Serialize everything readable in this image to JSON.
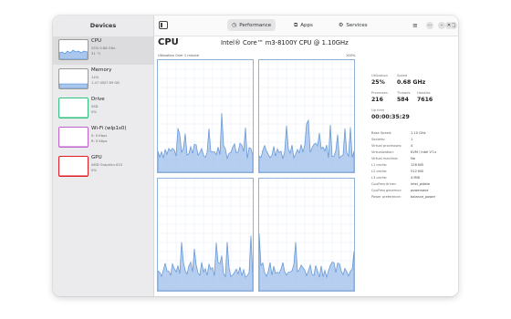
{
  "sidebar": {
    "title": "Devices",
    "items": [
      {
        "name": "CPU",
        "line1": "25% 0.68 GHz",
        "line2": "31 °C",
        "color": "#3584e4"
      },
      {
        "name": "Memory",
        "line1": "14%",
        "line2": "1.47 GB/7.69 GB",
        "color": "#3584e4"
      },
      {
        "name": "Drive",
        "line1": "SSD",
        "line2": "0%",
        "color": "#2ec27e"
      },
      {
        "name": "Wi-Fi (wlp1s0)",
        "line1": "S: 0 Kbps",
        "line2": "R: 0 Kbps",
        "color": "#c061cb"
      },
      {
        "name": "GPU",
        "line1": "AMD Graphics 615",
        "line2": "0%",
        "color": "#e01b24"
      }
    ]
  },
  "header": {
    "tabs": [
      {
        "icon": "performance-icon",
        "label": "Performance"
      },
      {
        "icon": "apps-icon",
        "label": "Apps"
      },
      {
        "icon": "services-icon",
        "label": "Services"
      }
    ]
  },
  "main": {
    "title": "CPU",
    "model": "Intel® Core™ m3-8100Y CPU @ 1.10GHz",
    "graph_label": "Utilization Over 1 minute",
    "graph_max": "100%"
  },
  "stats": {
    "utilization": {
      "label": "Utilization",
      "value": "25%"
    },
    "speed": {
      "label": "Speed",
      "value": "0.68 GHz"
    },
    "processes": {
      "label": "Processes",
      "value": "216"
    },
    "threads": {
      "label": "Threads",
      "value": "584"
    },
    "handles": {
      "label": "Handles",
      "value": "7616"
    },
    "uptime": {
      "label": "Up time",
      "value": "00:00:35:29"
    }
  },
  "info": [
    {
      "key": "Base Speed:",
      "value": "1.10 GHz"
    },
    {
      "key": "Sockets:",
      "value": "1"
    },
    {
      "key": "Virtual processors:",
      "value": "4"
    },
    {
      "key": "Virtualization:",
      "value": "KVM / Intel VT-x"
    },
    {
      "key": "Virtual machine:",
      "value": "No"
    },
    {
      "key": "L1 cache:",
      "value": "128 KiB"
    },
    {
      "key": "L2 cache:",
      "value": "512 KiB"
    },
    {
      "key": "L3 cache:",
      "value": "4 MiB"
    },
    {
      "key": "CpuFreq driver:",
      "value": "intel_pstate"
    },
    {
      "key": "CpuFreq governor:",
      "value": "powersave"
    },
    {
      "key": "Power preference:",
      "value": "balance_power"
    }
  ],
  "colors": {
    "graph_line": "#6a9ad6",
    "graph_fill": "#a9c6ec",
    "graph_border": "#8fb1d8"
  }
}
